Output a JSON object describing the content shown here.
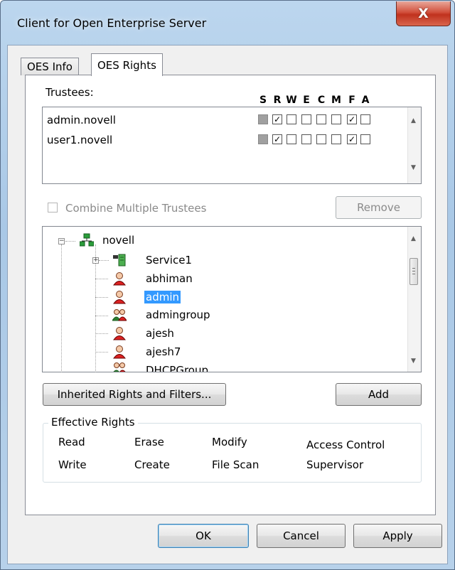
{
  "window": {
    "title": "Client for Open Enterprise Server",
    "close_glyph": "X"
  },
  "tabs": [
    {
      "label": "OES Info",
      "active": false
    },
    {
      "label": "OES Rights",
      "active": true
    }
  ],
  "trustees": {
    "label": "Trustees:",
    "rights_columns": [
      "S",
      "R",
      "W",
      "E",
      "C",
      "M",
      "F",
      "A"
    ],
    "rows": [
      {
        "name": "admin.novell",
        "rights": [
          null,
          true,
          false,
          false,
          false,
          false,
          true,
          false
        ]
      },
      {
        "name": "user1.novell",
        "rights": [
          null,
          true,
          false,
          false,
          false,
          false,
          true,
          false
        ]
      }
    ]
  },
  "combine": {
    "label": "Combine Multiple Trustees",
    "checked": false,
    "enabled": false
  },
  "remove_button": "Remove",
  "tree": {
    "root": {
      "label": "novell",
      "icon": "tree-org-icon"
    },
    "items": [
      {
        "label": "Service1",
        "icon": "server-icon",
        "expandable": true,
        "selected": false
      },
      {
        "label": "abhiman",
        "icon": "user-icon",
        "selected": false
      },
      {
        "label": "admin",
        "icon": "user-icon",
        "selected": true
      },
      {
        "label": "admingroup",
        "icon": "group-icon",
        "selected": false
      },
      {
        "label": "ajesh",
        "icon": "user-icon",
        "selected": false
      },
      {
        "label": "ajesh7",
        "icon": "user-icon",
        "selected": false
      },
      {
        "label": "DHCPGroup",
        "icon": "group-icon",
        "selected": false
      }
    ]
  },
  "inherited_button": "Inherited Rights and Filters...",
  "add_button": "Add",
  "effective_rights": {
    "title": "Effective Rights",
    "col1": [
      "Read",
      "Write"
    ],
    "col2": [
      "Erase",
      "Create"
    ],
    "col3": [
      "Modify",
      "File Scan"
    ],
    "col4": [
      "Access Control",
      "Supervisor"
    ]
  },
  "footer": {
    "ok": "OK",
    "cancel": "Cancel",
    "apply": "Apply"
  },
  "colors": {
    "selection": "#3399ff",
    "close_red": "#c0321e",
    "frame_blue": "#a9c8e6"
  }
}
